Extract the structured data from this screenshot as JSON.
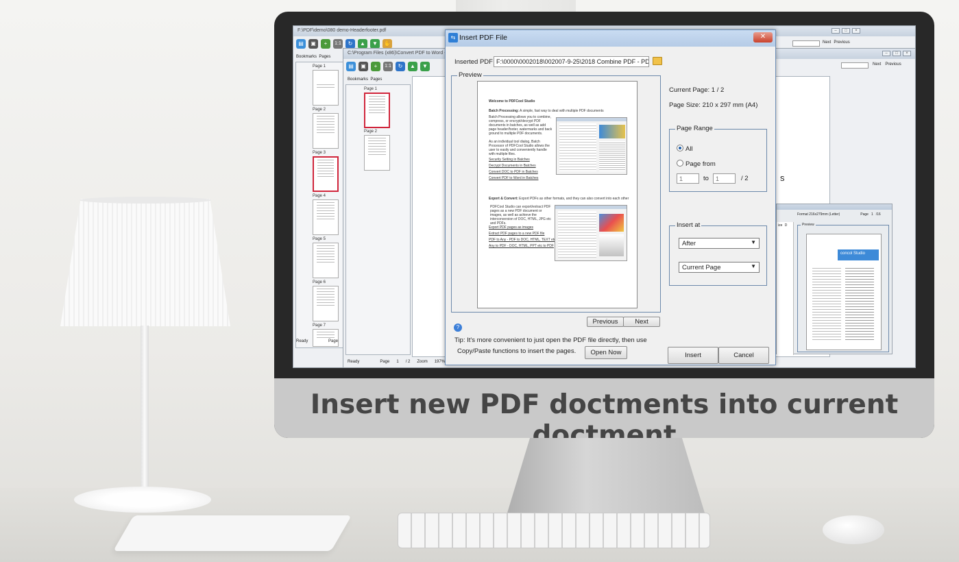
{
  "caption": "Insert new PDF doctments into current doctment",
  "back_window": {
    "title": "F:\\PDF\\demo\\080 demo-Headerfooter.pdf",
    "tabs": [
      "Bookmarks",
      "Pages"
    ],
    "page_labels": [
      "Page 1",
      "Page 2",
      "Page 3",
      "Page 4",
      "Page 5",
      "Page 6",
      "Page 7"
    ],
    "status": "Ready",
    "status_page": "Page",
    "nav_next": "Next",
    "nav_prev": "Previous"
  },
  "mid_window": {
    "title": "C:\\Program Files (x86)\\Convert PDF to Word - P",
    "tabs": [
      "Bookmarks",
      "Pages"
    ],
    "page_labels": [
      "Page 1",
      "Page 2"
    ],
    "status": "Ready",
    "status_page_label": "Page",
    "status_page_value": "1",
    "status_page_total": "/ 2",
    "status_zoom_label": "Zoom",
    "status_zoom_value": "197%",
    "nav_next": "Next",
    "nav_prev": "Previous",
    "partial_text": "s"
  },
  "right_window": {
    "format": "Format 216x279mm (Letter)",
    "page_label": "Page",
    "page_value": "1",
    "page_total": "/16",
    "preview": "Preview",
    "col_text": "ize",
    "col_d": "D",
    "brand": "concol Studio"
  },
  "dialog": {
    "title": "Insert PDF File",
    "inserted_label": "Inserted PDF",
    "inserted_path": "F:\\0000\\0002018\\002007-9-25\\2018 Combine PDF - PD",
    "preview_legend": "Preview",
    "current_page": "Current Page: 1 / 2",
    "page_size": "Page Size: 210 x 297 mm (A4)",
    "page_range_legend": "Page Range",
    "radio_all": "All",
    "radio_page_from": "Page from",
    "from_value": "1",
    "to_label": "to",
    "to_value": "1",
    "total": "/ 2",
    "insert_at_legend": "Insert at",
    "position_value": "After",
    "target_value": "Current Page",
    "prev_button": "Previous",
    "next_button": "Next",
    "tip_line1": "Tip: It's more convenient to just open the PDF file  directly, then use",
    "tip_line2": "Copy/Paste functions to insert the pages.",
    "open_now_button": "Open Now",
    "insert_button": "Insert",
    "cancel_button": "Cancel",
    "selected_option": "All",
    "doc": {
      "heading": "Welcome to PDFCool Studio",
      "batch_title": "Batch Processing:",
      "batch_intro": "A simple, fast way to deal with multiple PDF documents",
      "batch_body": "Batch Processing allows you to combine, compress, or encrypt/decrypt PDF documents in batches, as well as add page header/footer, watermarks and back ground to multiple PDF documents.",
      "batch_body2": "As an individual tool dialog, Batch Processor of PDFCool Studio allows the user to easily and conveniently handle with multiple files.",
      "links1": [
        "Security Setting in Batches",
        "Decrypt Documents in Batches",
        "Convert DOC to PDF in Batches",
        "Convert PDF to Word in Batches"
      ],
      "export_title": "Export & Convert:",
      "export_intro": "Export PDFs as other formats, and they can also convert into each other",
      "export_body": "PDFCool Studio can export/extract PDF pages as a new PDF document or images, as well as achieve the interconversion of DOC, HTML, JPG etc and PDFs.",
      "links2": [
        "Export PDF pages as images",
        "Extract PDF pages to a new PDF file",
        "PDF to Any - PDF to DOC, HTML, TEXT etc.",
        "Any to PDF - DOC, HTML, PPT etc to PDF"
      ]
    }
  }
}
